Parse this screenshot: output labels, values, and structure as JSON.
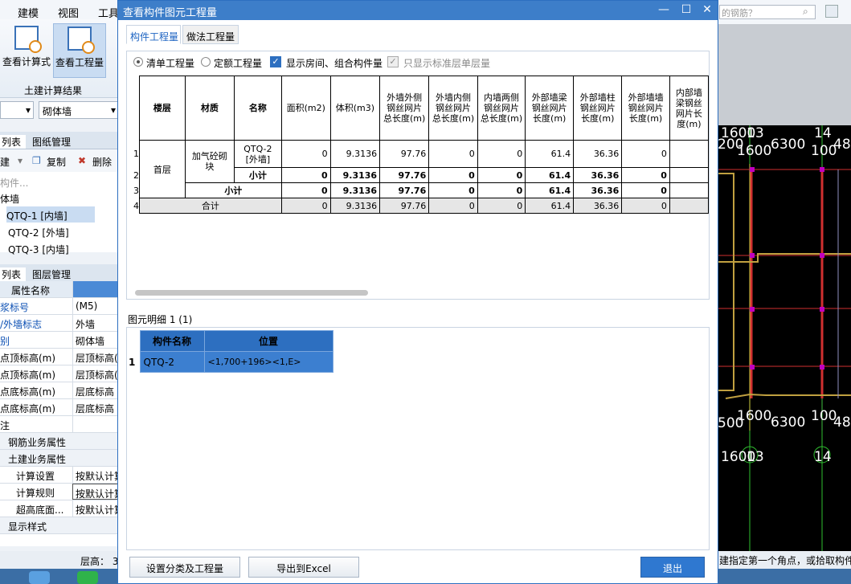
{
  "left_app": {
    "menu": [
      "建模",
      "视图",
      "工具"
    ],
    "ribbon_buttons": [
      "查看计算式",
      "查看工程量"
    ],
    "ribbon_group": "土建计算结果",
    "dropdowns": [
      "",
      "砌体墙"
    ],
    "tabs1": [
      "列表",
      "图纸管理"
    ],
    "toolbar": [
      "建",
      "复制",
      "删除"
    ],
    "search_placeholder": "构件...",
    "tree": [
      "体墙",
      "QTQ-1 [内墙]",
      "QTQ-2 [外墙]",
      "QTQ-3 [内墙]"
    ],
    "tabs2": [
      "列表",
      "图层管理"
    ],
    "prop_header": "属性名称",
    "properties": [
      {
        "k": "浆标号",
        "v": "(M5)"
      },
      {
        "k": "/外墙标志",
        "v": "外墙"
      },
      {
        "k": "别",
        "v": "砌体墙"
      },
      {
        "k": "点顶标高(m)",
        "v": "层顶标高("
      },
      {
        "k": "点顶标高(m)",
        "v": "层顶标高("
      },
      {
        "k": "点底标高(m)",
        "v": "层底标高"
      },
      {
        "k": "点底标高(m)",
        "v": "层底标高"
      },
      {
        "k": "注",
        "v": ""
      },
      {
        "k": "钢筋业务属性",
        "v": ""
      },
      {
        "k": "土建业务属性",
        "v": ""
      },
      {
        "k": "计算设置",
        "v": "按默认计算"
      },
      {
        "k": "计算规则",
        "v": "按默认计算"
      },
      {
        "k": "超高底面...",
        "v": "按默认计算"
      },
      {
        "k": "显示样式",
        "v": ""
      }
    ],
    "status": "层高： 3"
  },
  "dialog": {
    "title": "查看构件图元工程量",
    "tabs": [
      "构件工程量",
      "做法工程量"
    ],
    "options": {
      "radio1": "清单工程量",
      "radio2": "定额工程量",
      "check1": "显示房间、组合构件量",
      "check2": "只显示标准层单层量"
    },
    "table": {
      "headers": [
        "楼层",
        "材质",
        "名称",
        "面积(m2)",
        "体积(m3)",
        "外墙外侧钢丝网片总长度(m)",
        "外墙内侧钢丝网片总长度(m)",
        "内墙两侧钢丝网片总长度(m)",
        "外部墙梁钢丝网片长度(m)",
        "外部墙柱钢丝网片长度(m)",
        "外部墙墙钢丝网片长度(m)",
        "内部墙梁钢丝网片长度(m)"
      ],
      "row_nums": [
        "1",
        "2",
        "3",
        "4"
      ],
      "floor": "首层",
      "material": "加气砼砌块",
      "name": "QTQ-2 [外墙]",
      "subtotal": "小计",
      "total": "合计",
      "values": [
        "0",
        "9.3136",
        "97.76",
        "0",
        "0",
        "61.4",
        "36.36",
        "0"
      ]
    },
    "detail_label": "图元明细",
    "detail_count": "1 (1)",
    "detail_headers": [
      "构件名称",
      "位置"
    ],
    "detail_row": {
      "num": "1",
      "name": "QTQ-2",
      "pos": "<1,700+196><1,E>"
    },
    "buttons": [
      "设置分类及工程量",
      "导出到Excel",
      "退出"
    ]
  },
  "right_app": {
    "search_text": "的钢筋？",
    "cad_labels": [
      "1600",
      "13",
      "14",
      "200",
      "1600",
      "6300",
      "100",
      "480",
      "500",
      "1600",
      "6300",
      "100",
      "480",
      "1600",
      "13",
      "14"
    ],
    "status": "建指定第一个角点，或拾取构件图"
  }
}
